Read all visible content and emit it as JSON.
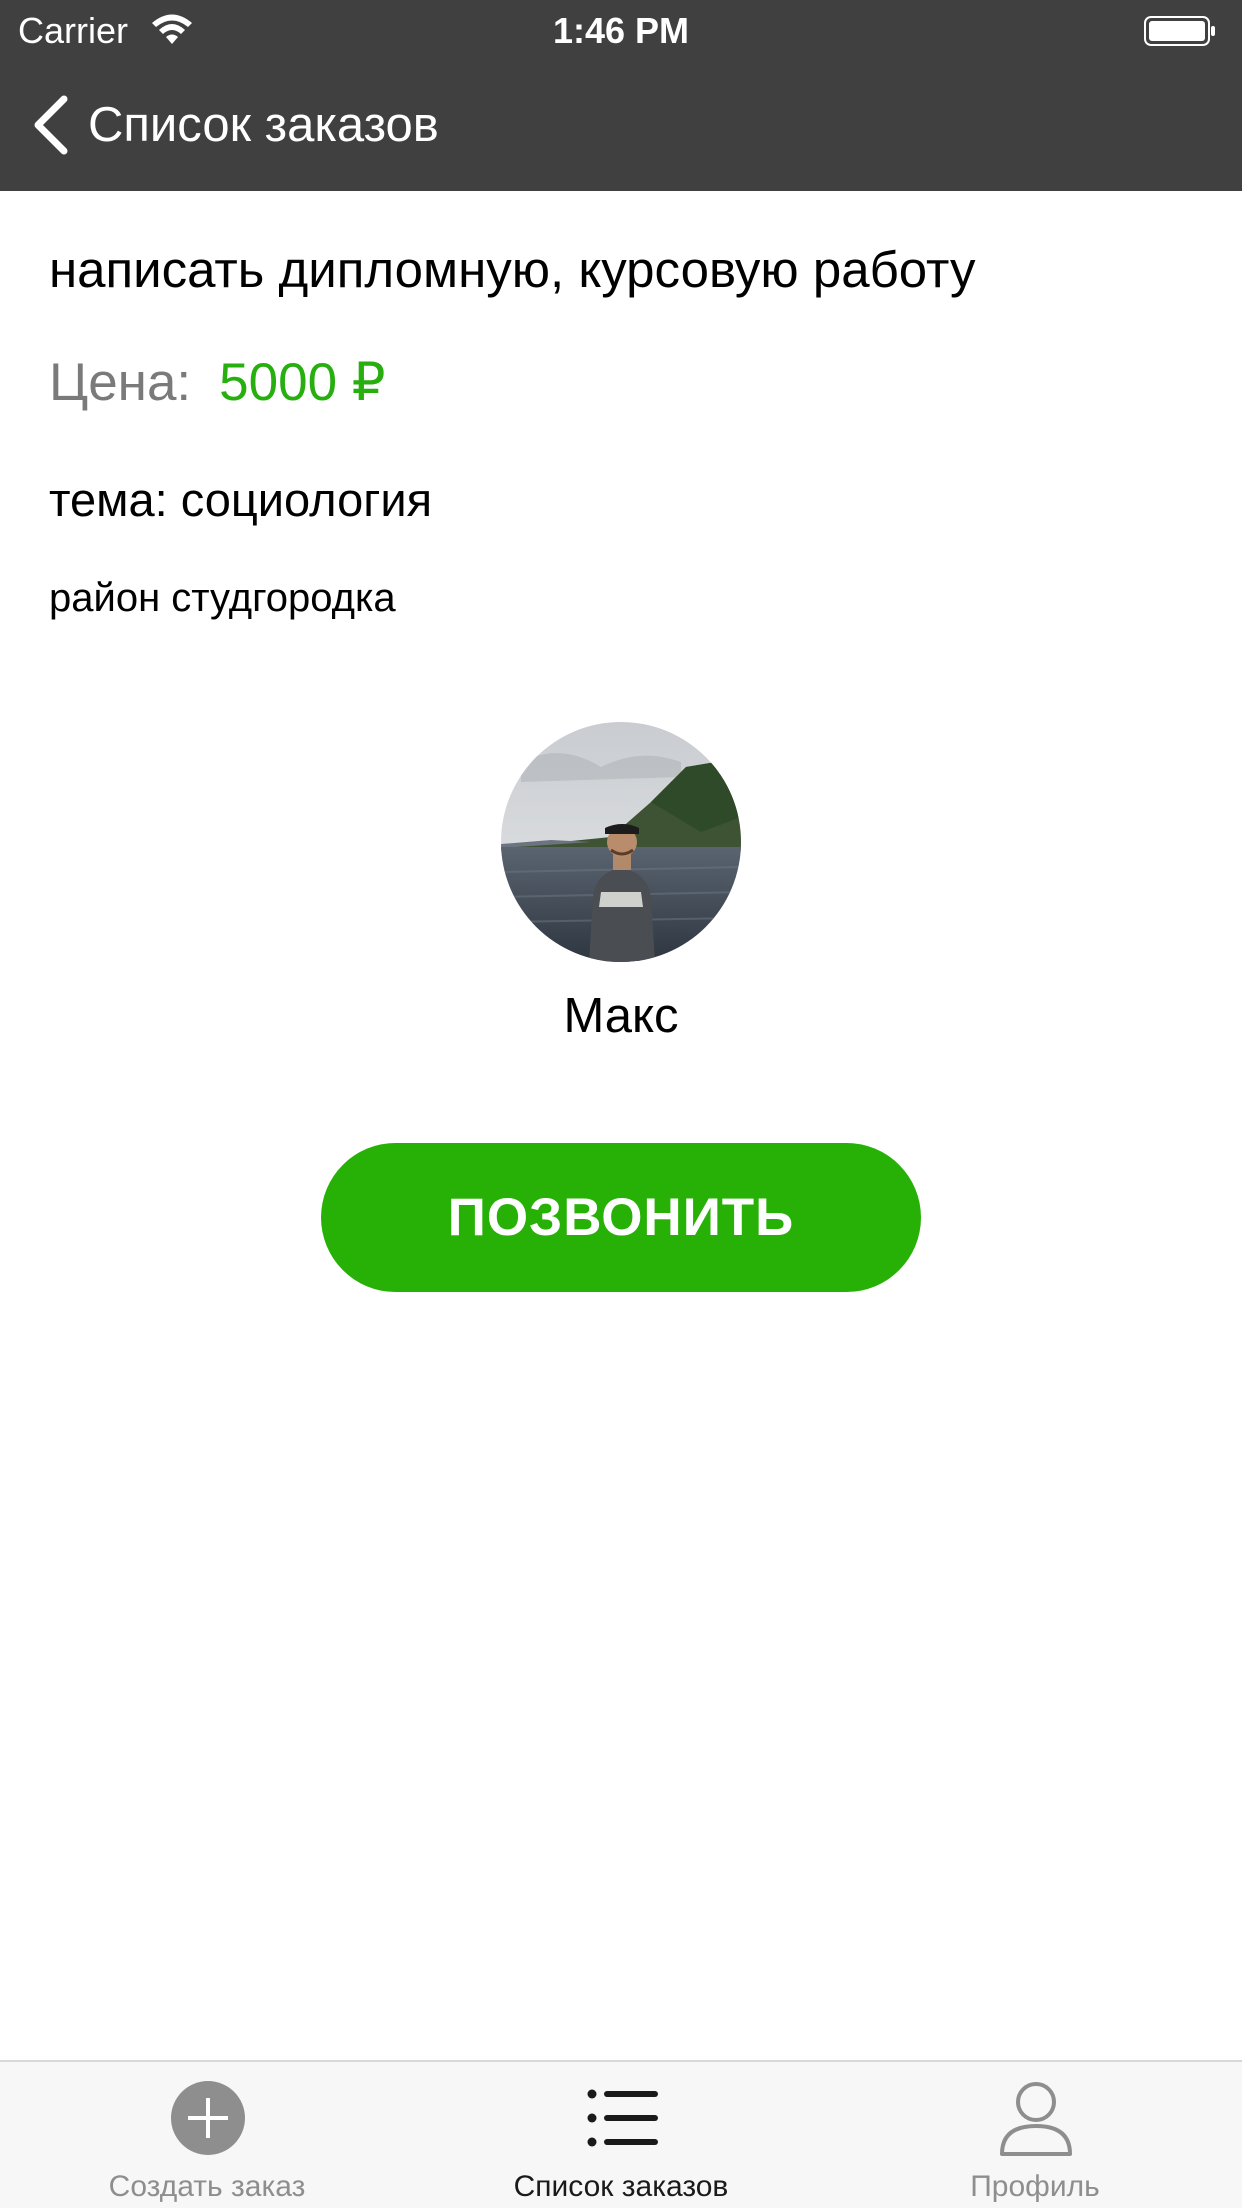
{
  "status_bar": {
    "carrier": "Carrier",
    "time": "1:46 PM"
  },
  "nav": {
    "back_label": "Список заказов"
  },
  "order": {
    "title": "написать дипломную, курсовую работу",
    "price_label": "Цена:",
    "price_value": "5000 ₽",
    "topic": "тема: социология",
    "district": "район студгородка"
  },
  "customer": {
    "name": "Макс"
  },
  "actions": {
    "call_label": "ПОЗВОНИТЬ"
  },
  "tab_bar": {
    "tabs": [
      {
        "label": "Создать заказ",
        "icon": "plus-circle-icon",
        "active": false
      },
      {
        "label": "Список заказов",
        "icon": "list-icon",
        "active": true
      },
      {
        "label": "Профиль",
        "icon": "person-icon",
        "active": false
      }
    ]
  },
  "colors": {
    "header": "#404040",
    "accent_green": "#27b106",
    "price_green": "#27ae0f",
    "tab_inactive": "#8e8e8e",
    "tab_active": "#1a1a1a"
  }
}
